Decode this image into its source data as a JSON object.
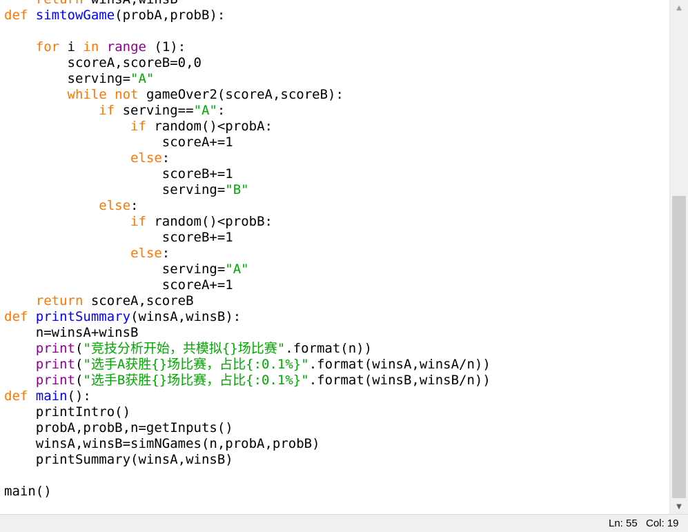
{
  "editor": {
    "lines": [
      [
        [
          "plain",
          "    "
        ],
        [
          "kw",
          "return"
        ],
        [
          "plain",
          " winsA,winsB"
        ]
      ],
      [
        [
          "kw",
          "def"
        ],
        [
          "plain",
          " "
        ],
        [
          "def",
          "simtowGame"
        ],
        [
          "plain",
          "(probA,probB):"
        ]
      ],
      [
        [
          "plain",
          ""
        ]
      ],
      [
        [
          "plain",
          "    "
        ],
        [
          "kw",
          "for"
        ],
        [
          "plain",
          " i "
        ],
        [
          "kw",
          "in"
        ],
        [
          "plain",
          " "
        ],
        [
          "builtin",
          "range"
        ],
        [
          "plain",
          " (1):"
        ]
      ],
      [
        [
          "plain",
          "        scoreA,scoreB=0,0"
        ]
      ],
      [
        [
          "plain",
          "        serving="
        ],
        [
          "str",
          "\"A\""
        ]
      ],
      [
        [
          "plain",
          "        "
        ],
        [
          "kw",
          "while"
        ],
        [
          "plain",
          " "
        ],
        [
          "kw",
          "not"
        ],
        [
          "plain",
          " gameOver2(scoreA,scoreB):"
        ]
      ],
      [
        [
          "plain",
          "            "
        ],
        [
          "kw",
          "if"
        ],
        [
          "plain",
          " serving=="
        ],
        [
          "str",
          "\"A\""
        ],
        [
          "plain",
          ":"
        ]
      ],
      [
        [
          "plain",
          "                "
        ],
        [
          "kw",
          "if"
        ],
        [
          "plain",
          " random()<probA:"
        ]
      ],
      [
        [
          "plain",
          "                    scoreA+=1"
        ]
      ],
      [
        [
          "plain",
          "                "
        ],
        [
          "kw",
          "else"
        ],
        [
          "plain",
          ":"
        ]
      ],
      [
        [
          "plain",
          "                    scoreB+=1"
        ]
      ],
      [
        [
          "plain",
          "                    serving="
        ],
        [
          "str",
          "\"B\""
        ]
      ],
      [
        [
          "plain",
          "            "
        ],
        [
          "kw",
          "else"
        ],
        [
          "plain",
          ":"
        ]
      ],
      [
        [
          "plain",
          "                "
        ],
        [
          "kw",
          "if"
        ],
        [
          "plain",
          " random()<probB:"
        ]
      ],
      [
        [
          "plain",
          "                    scoreB+=1"
        ]
      ],
      [
        [
          "plain",
          "                "
        ],
        [
          "kw",
          "else"
        ],
        [
          "plain",
          ":"
        ]
      ],
      [
        [
          "plain",
          "                    serving="
        ],
        [
          "str",
          "\"A\""
        ]
      ],
      [
        [
          "plain",
          "                    scoreA+=1"
        ]
      ],
      [
        [
          "plain",
          "    "
        ],
        [
          "kw",
          "return"
        ],
        [
          "plain",
          " scoreA,scoreB"
        ]
      ],
      [
        [
          "kw",
          "def"
        ],
        [
          "plain",
          " "
        ],
        [
          "def",
          "printSummary"
        ],
        [
          "plain",
          "(winsA,winsB):"
        ]
      ],
      [
        [
          "plain",
          "    n=winsA+winsB"
        ]
      ],
      [
        [
          "plain",
          "    "
        ],
        [
          "builtin",
          "print"
        ],
        [
          "plain",
          "("
        ],
        [
          "str",
          "\"竞技分析开始，共模拟{}场比赛\""
        ],
        [
          "plain",
          ".format(n))"
        ]
      ],
      [
        [
          "plain",
          "    "
        ],
        [
          "builtin",
          "print"
        ],
        [
          "plain",
          "("
        ],
        [
          "str",
          "\"选手A获胜{}场比赛，占比{:0.1%}\""
        ],
        [
          "plain",
          ".format(winsA,winsA/n))"
        ]
      ],
      [
        [
          "plain",
          "    "
        ],
        [
          "builtin",
          "print"
        ],
        [
          "plain",
          "("
        ],
        [
          "str",
          "\"选手B获胜{}场比赛，占比{:0.1%}\""
        ],
        [
          "plain",
          ".format(winsB,winsB/n))"
        ]
      ],
      [
        [
          "kw",
          "def"
        ],
        [
          "plain",
          " "
        ],
        [
          "def",
          "main"
        ],
        [
          "plain",
          "():"
        ]
      ],
      [
        [
          "plain",
          "    printIntro()"
        ]
      ],
      [
        [
          "plain",
          "    probA,probB,n=getInputs()"
        ]
      ],
      [
        [
          "plain",
          "    winsA,winsB=simNGames(n,probA,probB)"
        ]
      ],
      [
        [
          "plain",
          "    printSummary(winsA,winsB)"
        ]
      ],
      [
        [
          "plain",
          ""
        ]
      ],
      [
        [
          "plain",
          "main()"
        ]
      ]
    ]
  },
  "scrollbar": {
    "up_icon": "▲",
    "down_icon": "▼"
  },
  "statusbar": {
    "line": "Ln: 55",
    "column": "Col: 19"
  },
  "colors": {
    "keyword": "#ff7700",
    "builtin": "#900090",
    "definition": "#0000ff",
    "string": "#00aa00",
    "text": "#000000"
  }
}
